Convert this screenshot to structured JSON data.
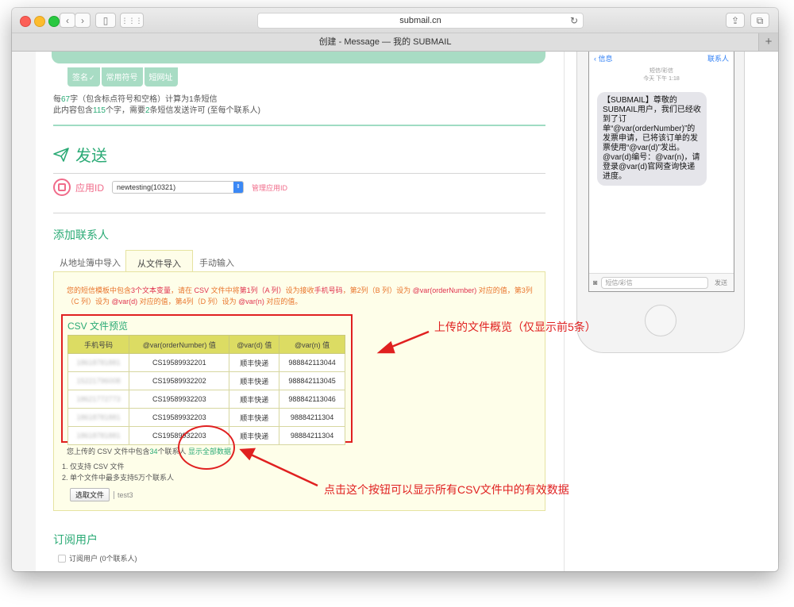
{
  "browser": {
    "url": "submail.cn",
    "tab_title": "创建 - Message — 我的 SUBMAIL",
    "new_tab": "+"
  },
  "toolbar_tabs": [
    {
      "label": "签名"
    },
    {
      "label": "常用符号"
    },
    {
      "label": "短网址"
    }
  ],
  "count": {
    "line1_pre": "每",
    "line1_num": "67",
    "line1_post": "字（包含标点符号和空格）计算为1条短信",
    "line2_pre": "此内容包含",
    "line2_num": "115",
    "line2_mid": "个字，需要",
    "line2_num2": "2",
    "line2_post": "条短信发送许可 (至每个联系人)"
  },
  "send": {
    "title": "发送"
  },
  "appid": {
    "label": "应用ID",
    "selected": "newtesting(10321)",
    "manage": "管理应用ID"
  },
  "contacts": {
    "title": "添加联系人",
    "tabs": [
      {
        "label": "从地址簿中导入"
      },
      {
        "label": "从文件导入"
      },
      {
        "label": "手动输入"
      }
    ]
  },
  "intro": {
    "p1": "您的短信模板中包含",
    "p2": "3个文本变量",
    "p3": "，请在 ",
    "p4": "CSV",
    "p5": " 文件中将",
    "p6": "第1列（A 列）",
    "p7": "设为接收",
    "p8": "手机号码",
    "p9": "，第2列（B 列）设为 ",
    "p10": "@var(orderNumber)",
    "p11": " 对应的值，第3列（C 列）设为 ",
    "p12": "@var(d)",
    "p13": " 对应的值，第4列（D 列）设为 ",
    "p14": "@var(n)",
    "p15": " 对应的值。"
  },
  "csv_preview": {
    "title": "CSV 文件预览",
    "headers": [
      "手机号码",
      "@var(orderNumber) 值",
      "@var(d) 值",
      "@var(n) 值"
    ],
    "rows": [
      [
        "18618781881",
        "CS19589932201",
        "顺丰快递",
        "988842113044"
      ],
      [
        "15221796008",
        "CS19589932202",
        "顺丰快递",
        "988842113045"
      ],
      [
        "18621772773",
        "CS19589932203",
        "顺丰快递",
        "988842113046"
      ],
      [
        "18618781881",
        "CS19589932203",
        "顺丰快递",
        "98884211304"
      ],
      [
        "18618781881",
        "CS19589932203",
        "顺丰快递",
        "98884211304"
      ]
    ]
  },
  "csv_note": {
    "pre": "您上传的 CSV 文件中包含",
    "num": "34",
    "post": "个联系人 ",
    "show_all": "显示全部数据"
  },
  "rules": [
    "1.  仅支持 CSV 文件",
    "2.  单个文件中最多支持5万个联系人"
  ],
  "file": {
    "button": "选取文件",
    "name": "test3"
  },
  "subscribe": {
    "title": "订阅用户",
    "checkbox": "订阅用户 (0个联系人)"
  },
  "annotations": {
    "preview_note": "上传的文件概览（仅显示前5条）",
    "show_all_note": "点击这个按钮可以显示所有CSV文件中的有效数据"
  },
  "phone": {
    "back": "信息",
    "contact": "联系人",
    "sub1": "短信/彩信",
    "sub2": "今天 下午 1:18",
    "message": "【SUBMAIL】尊敬的SUBMAIL用户，我们已经收到了订单“@var(orderNumber)”的发票申请，已将该订单的发票使用“@var(d)”发出。@var(d)编号：@var(n)，请登录@var(d)官网查询快递进度。",
    "input_placeholder": "短信/彩信",
    "send": "发送"
  },
  "colors": {
    "accent_green": "#2aaa75",
    "pink": "#f06b8a",
    "annotation_red": "#e02020",
    "panel_bg": "#fefee9",
    "table_header": "#dcdc63"
  }
}
